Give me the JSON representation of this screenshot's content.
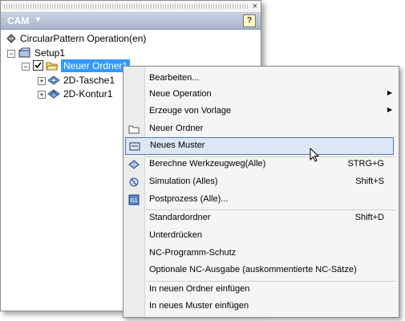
{
  "panel": {
    "title": "CAM",
    "help_label": "?",
    "close_label": "×"
  },
  "tree": {
    "root_label": "CircularPattern Operation(en)",
    "setup_label": "Setup1",
    "folder_label": "Neuer Ordner1",
    "op1_label": "2D-Tasche1",
    "op2_label": "2D-Kontur1"
  },
  "menu": {
    "items": [
      {
        "label": "Bearbeiten..."
      },
      {
        "label": "Neue Operation"
      },
      {
        "label": "Erzeuge von Vorlage"
      },
      {
        "label": "Neuer Ordner"
      },
      {
        "label": "Neues Muster"
      },
      {
        "label": "Berechne Werkzeugweg(Alle)",
        "shortcut": "STRG+G"
      },
      {
        "label": "Simulation (Alles)",
        "shortcut": "Shift+S"
      },
      {
        "label": "Postprozess (Alle)..."
      },
      {
        "label": "Standardordner",
        "shortcut": "Shift+D"
      },
      {
        "label": "Unterdrücken"
      },
      {
        "label": "NC-Programm-Schutz"
      },
      {
        "label": "Optionale NC-Ausgabe (auskommentierte NC-Sätze)"
      },
      {
        "label": "In neuen Ordner einfügen"
      },
      {
        "label": "In neues Muster einfügen"
      }
    ]
  },
  "colors": {
    "header_bg": "#b4bfd4",
    "selection": "#3399ff",
    "hover": "#dde6f5"
  }
}
